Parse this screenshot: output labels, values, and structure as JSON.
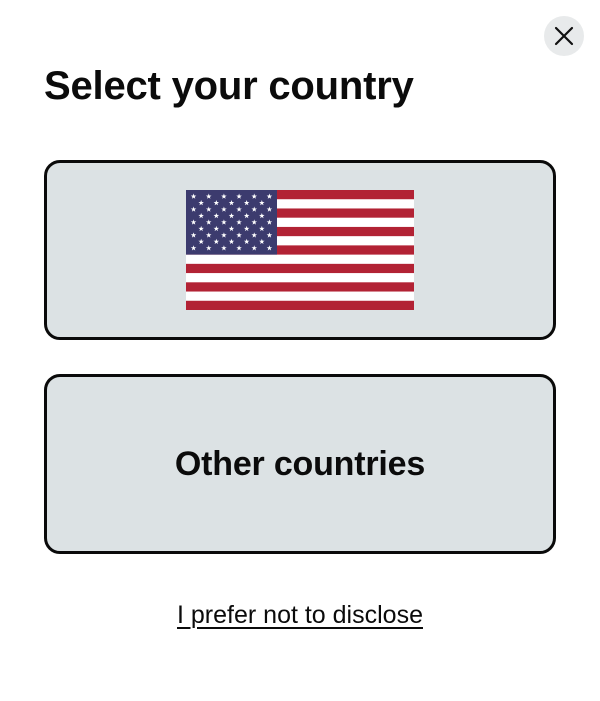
{
  "dialog": {
    "title": "Select your country",
    "close_icon": "close-icon",
    "options": [
      {
        "id": "us",
        "icon": "us-flag-icon",
        "label": ""
      },
      {
        "id": "other",
        "label": "Other countries"
      }
    ],
    "decline_link": "I prefer not to disclose"
  },
  "colors": {
    "option_background": "#dce2e4",
    "option_border": "#0a0a0a",
    "close_background": "#e8eaeb",
    "flag_red": "#b22234",
    "flag_blue": "#3c3b6e",
    "flag_white": "#ffffff"
  }
}
